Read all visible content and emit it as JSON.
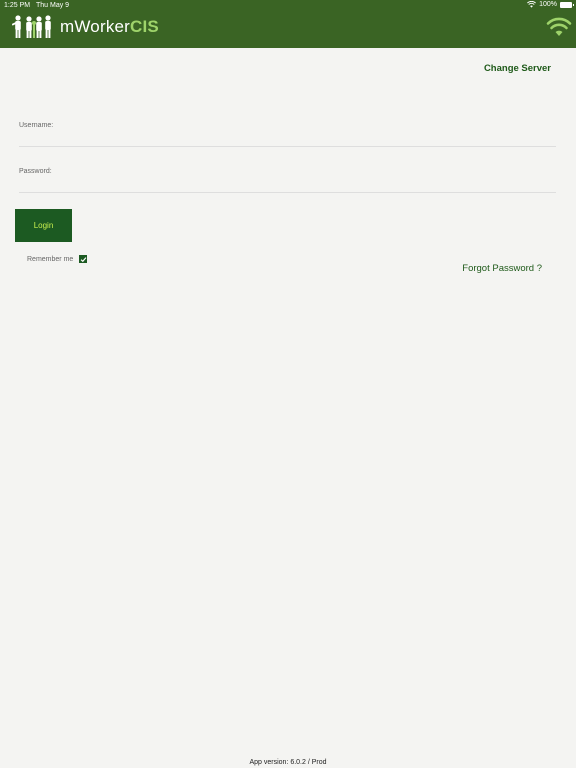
{
  "status_bar": {
    "time": "1:25 PM",
    "date": "Thu May 9",
    "battery": "100%"
  },
  "header": {
    "logo_prefix": "mWorker",
    "logo_accent": "CIS",
    "logo_icon": "people-group-icon",
    "wifi_icon": "wifi-icon",
    "background_color": "#3a6424"
  },
  "change_server_label": "Change Server",
  "login_form": {
    "username_label": "Username:",
    "username_value": "",
    "password_label": "Password:",
    "password_value": "",
    "login_button_label": "Login",
    "remember_me_label": "Remember me",
    "remember_me_checked": true
  },
  "forgot_password_label": "Forgot Password ?",
  "footer": {
    "app_version": "App version: 6.0.2 / Prod"
  },
  "colors": {
    "accent": "#1c5a22",
    "accent_text": "#c8f04e"
  }
}
